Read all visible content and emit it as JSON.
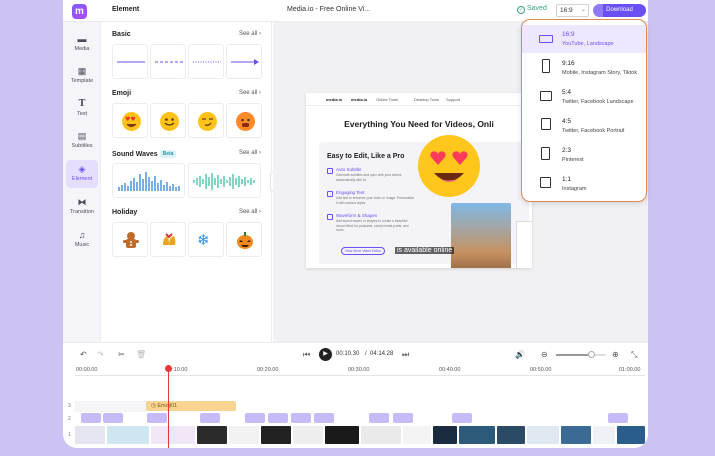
{
  "topbar": {
    "panel_title": "Element",
    "doc_title": "Media.io - Free Online Vi...",
    "saved": "Saved",
    "ratio_value": "16:9",
    "download": "Download"
  },
  "sidebar": {
    "items": [
      {
        "label": "Media",
        "icon": "folder-icon"
      },
      {
        "label": "Template",
        "icon": "grid-icon"
      },
      {
        "label": "Text",
        "icon": "text-icon"
      },
      {
        "label": "Subtitles",
        "icon": "subtitles-icon"
      },
      {
        "label": "Element",
        "icon": "element-icon"
      },
      {
        "label": "Transition",
        "icon": "transition-icon"
      },
      {
        "label": "Music",
        "icon": "music-icon"
      }
    ]
  },
  "elements": {
    "see_all": "See all",
    "basic": "Basic",
    "emoji": "Emoji",
    "sound_waves": "Sound Waves",
    "beta": "Beta",
    "holiday": "Holiday"
  },
  "preview": {
    "headline": "Everything You Need for Videos, Onli",
    "card_title": "Easy to Edit, Like a Pro",
    "features": [
      {
        "title": "Auto Subtitle",
        "desc": "Generate subtitles and sync with your videos automatically with AI."
      },
      {
        "title": "Engaging Text",
        "desc": "Add text to enhance your video or image. Personalize it with various styles."
      },
      {
        "title": "Waveform & Shapes",
        "desc": "Add sound waves or shapes to create a beautiful visual effect for podcasts, social media posts, and more."
      }
    ],
    "button": "View More Video Editor",
    "caption": "is available online",
    "nav": [
      "media.io",
      "Online Tools",
      "Desktop Tools",
      "Support"
    ]
  },
  "ratio_dropdown": [
    {
      "ratio": "16:9",
      "desc": "YouTube, Landscape",
      "selected": true
    },
    {
      "ratio": "9:16",
      "desc": "Mobile, Instagram Story, Tiktok",
      "selected": false
    },
    {
      "ratio": "5:4",
      "desc": "Twitter, Facebook Landscape",
      "selected": false
    },
    {
      "ratio": "4:5",
      "desc": "Twitter, Facebook Portrait",
      "selected": false
    },
    {
      "ratio": "2:3",
      "desc": "Pinterest",
      "selected": false
    },
    {
      "ratio": "1:1",
      "desc": "Instagram",
      "selected": false
    }
  ],
  "timeline": {
    "current_time": "00:10.30",
    "separator": "/",
    "total_time": "04:14.28",
    "ruler": [
      "00:00.00",
      "00:10.00",
      "00:20.00",
      "00:30.00",
      "00:40.00",
      "00:50.00",
      "01:00.00"
    ],
    "emoji_clip": "Emoji01",
    "tracks": [
      "3",
      "2",
      "1"
    ],
    "zoom_level": 0.7
  },
  "colors": {
    "accent": "#6a4ff5",
    "highlight_border": "#e08a56",
    "background": "#ccc3f3"
  }
}
